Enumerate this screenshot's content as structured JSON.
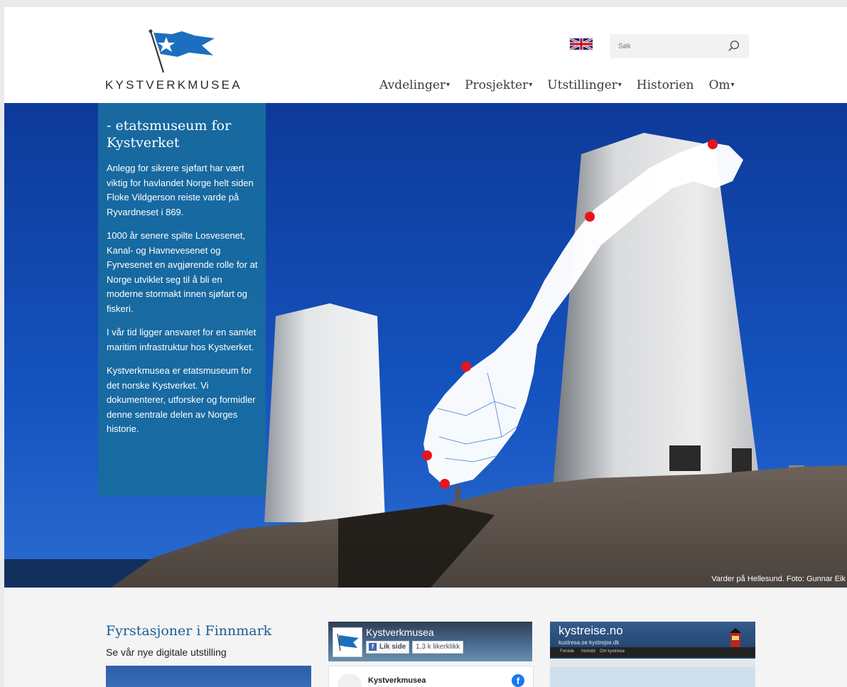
{
  "header": {
    "logo_text": "KYSTVERKMUSEA",
    "search_placeholder": "Søk",
    "language": "english-flag-icon",
    "nav": [
      {
        "label": "Avdelinger",
        "dropdown": true
      },
      {
        "label": "Prosjekter",
        "dropdown": true
      },
      {
        "label": "Utstillinger",
        "dropdown": true
      },
      {
        "label": "Historien",
        "dropdown": false
      },
      {
        "label": "Om",
        "dropdown": true
      }
    ],
    "caret": "▾"
  },
  "hero": {
    "title": "- etatsmuseum for Kystverket",
    "paragraphs": [
      "Anlegg for sikrere sjøfart har vært viktig for havlandet Norge helt siden Floke Vildgerson reiste varde på Ryvardneset i 869.",
      "1000 år senere spilte Losvesenet, Kanal- og Havnevesenet og Fyrvesenet en avgjørende rolle for at Norge utviklet seg til å bli en moderne stormakt innen sjøfart og fiskeri.",
      "I vår tid ligger ansvaret for en samlet maritim infrastruktur hos Kystverket.",
      "Kystverkmusea er etatsmuseum for det norske Kystverket. Vi dokumenterer, utforsker og formidler denne sentrale delen av Norges historie."
    ],
    "photo_credit": "Varder på Hellesund. Foto: Gunnar Eik"
  },
  "lower": {
    "feature_title": "Fyrstasjoner i Finnmark",
    "feature_subtitle": "Se vår nye digitale utstilling",
    "facebook": {
      "page_name": "Kystverkmusea",
      "like_label": "Lik side",
      "like_count": "1,3 k likerklikk",
      "card_name": "Kystverkmusea"
    },
    "kystreise": {
      "title": "kystreise.no",
      "subtitle": "kustresa.se  kystrejse.dk",
      "nav_items": [
        "Forside",
        "Innhold",
        "Om kystreise"
      ]
    }
  },
  "colors": {
    "panel": "#186ba0",
    "sky": "#0f43a6",
    "link": "#1b5e93",
    "marker": "#e8141c"
  }
}
